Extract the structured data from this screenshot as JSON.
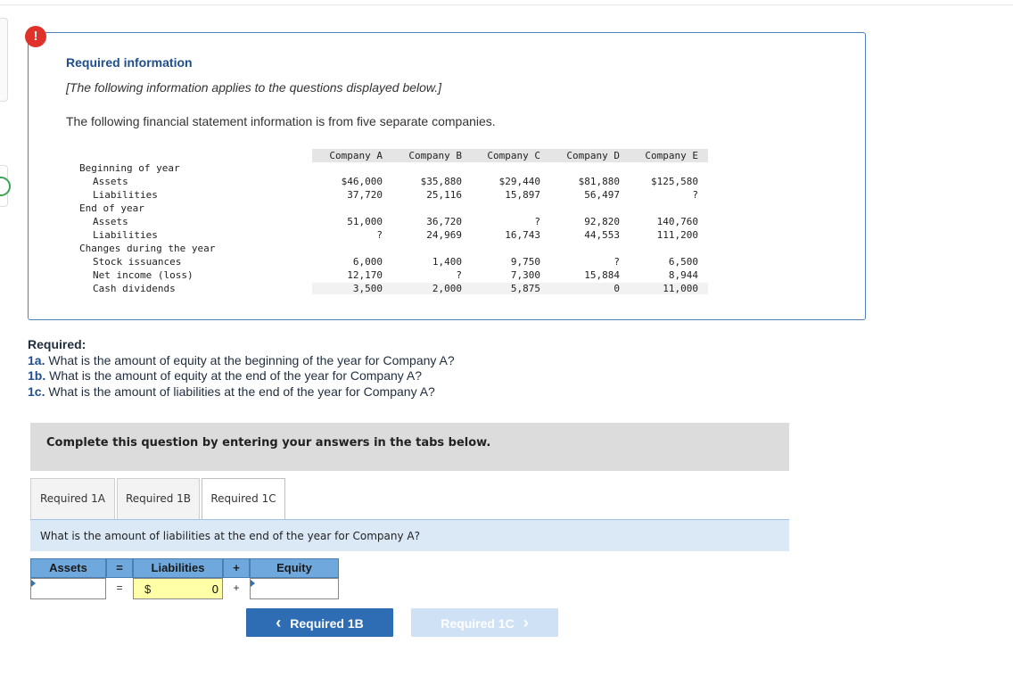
{
  "info": {
    "alert_glyph": "!",
    "title": "Required information",
    "note": "[The following information applies to the questions displayed below.]",
    "intro": "The following financial statement information is from five separate companies."
  },
  "table": {
    "columns": [
      "Company A",
      "Company B",
      "Company C",
      "Company D",
      "Company E"
    ],
    "sections": [
      {
        "label": "Beginning of year",
        "rows": [
          {
            "label": "Assets",
            "values": [
              "$46,000",
              "$35,880",
              "$29,440",
              "$81,880",
              "$125,580"
            ]
          },
          {
            "label": "Liabilities",
            "values": [
              "37,720",
              "25,116",
              "15,897",
              "56,497",
              "?"
            ]
          }
        ]
      },
      {
        "label": "End of year",
        "rows": [
          {
            "label": "Assets",
            "values": [
              "51,000",
              "36,720",
              "?",
              "92,820",
              "140,760"
            ]
          },
          {
            "label": "Liabilities",
            "values": [
              "?",
              "24,969",
              "16,743",
              "44,553",
              "111,200"
            ]
          }
        ]
      },
      {
        "label": "Changes during the year",
        "rows": [
          {
            "label": "Stock issuances",
            "values": [
              "6,000",
              "1,400",
              "9,750",
              "?",
              "6,500"
            ]
          },
          {
            "label": "Net income (loss)",
            "values": [
              "12,170",
              "?",
              "7,300",
              "15,884",
              "8,944"
            ]
          },
          {
            "label": "Cash dividends",
            "values": [
              "3,500",
              "2,000",
              "5,875",
              "0",
              "11,000"
            ]
          }
        ]
      }
    ]
  },
  "required": {
    "heading": "Required:",
    "items": [
      {
        "num": "1a.",
        "text": " What is the amount of equity at the beginning of the year for Company A?"
      },
      {
        "num": "1b.",
        "text": " What is the amount of equity at the end of the year for Company A?"
      },
      {
        "num": "1c.",
        "text": " What is the amount of liabilities at the end of the year for Company A?"
      }
    ]
  },
  "complete_instruction": "Complete this question by entering your answers in the tabs below.",
  "tabs": [
    {
      "label": "Required 1A",
      "active": false
    },
    {
      "label": "Required 1B",
      "active": false
    },
    {
      "label": "Required 1C",
      "active": true
    }
  ],
  "question": "What is the amount of liabilities at the end of the year for Company A?",
  "equation": {
    "headers": {
      "assets": "Assets",
      "eq": "=",
      "liabilities": "Liabilities",
      "plus": "+",
      "equity": "Equity"
    },
    "row": {
      "assets_value": "",
      "eq": "=",
      "currency": "$",
      "liabilities_value": "0",
      "plus": "+",
      "equity_value": ""
    }
  },
  "nav": {
    "prev_label": "Required 1B",
    "next_label": "Required 1C",
    "prev_glyph": "‹",
    "next_glyph": "›"
  }
}
